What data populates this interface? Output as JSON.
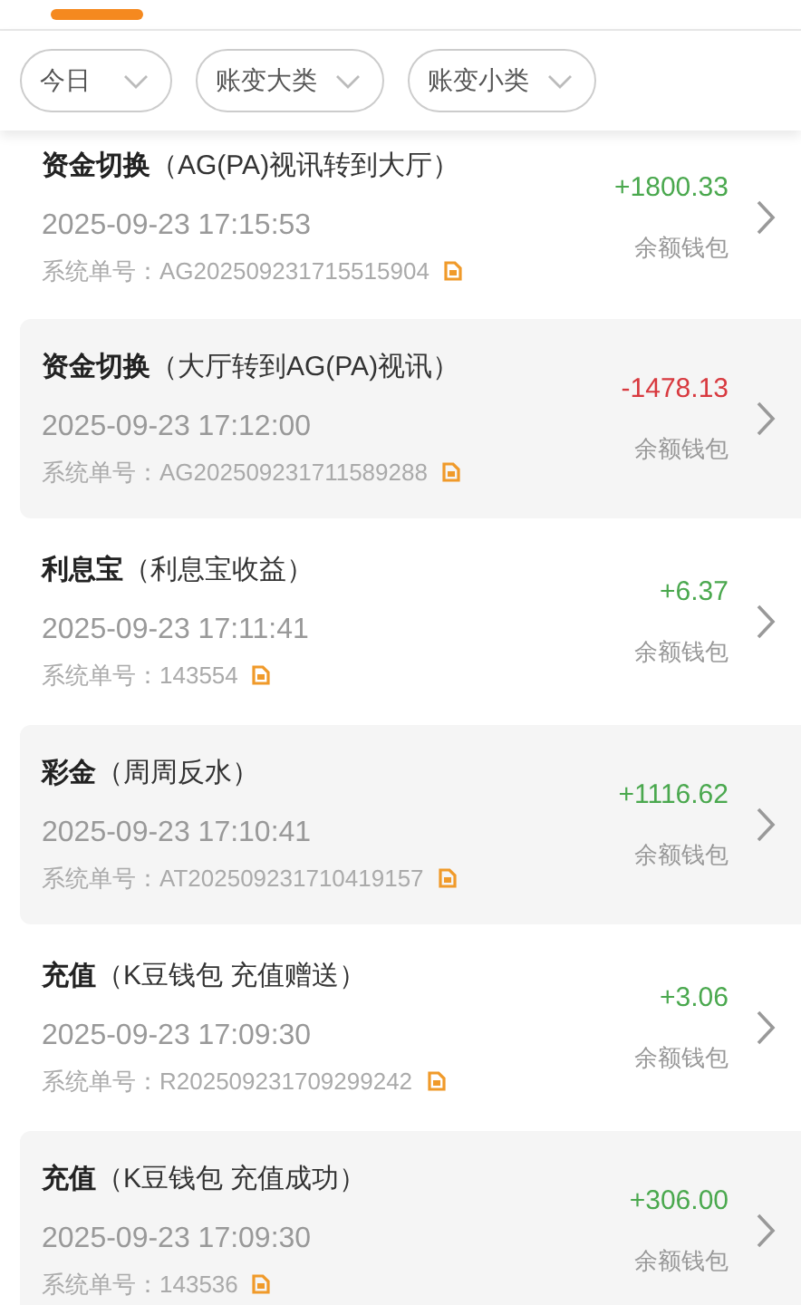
{
  "filters": [
    {
      "label": "今日"
    },
    {
      "label": "账变大类"
    },
    {
      "label": "账变小类"
    }
  ],
  "records": [
    {
      "category": "资金切换",
      "detail": "（AG(PA)视讯转到大厅）",
      "time": "2025-09-23 17:15:53",
      "order_label": "系统单号：",
      "order_no": "AG202509231715515904",
      "amount": "+1800.33",
      "kind": "credit",
      "wallet": "余额钱包"
    },
    {
      "category": "资金切换",
      "detail": "（大厅转到AG(PA)视讯）",
      "time": "2025-09-23 17:12:00",
      "order_label": "系统单号：",
      "order_no": "AG202509231711589288",
      "amount": "-1478.13",
      "kind": "debit",
      "wallet": "余额钱包"
    },
    {
      "category": "利息宝",
      "detail": "（利息宝收益）",
      "time": "2025-09-23 17:11:41",
      "order_label": "系统单号：",
      "order_no": "143554",
      "amount": "+6.37",
      "kind": "credit",
      "wallet": "余额钱包"
    },
    {
      "category": "彩金",
      "detail": "（周周反水）",
      "time": "2025-09-23 17:10:41",
      "order_label": "系统单号：",
      "order_no": "AT202509231710419157",
      "amount": "+1116.62",
      "kind": "credit",
      "wallet": "余额钱包"
    },
    {
      "category": "充值",
      "detail": "（K豆钱包 充值赠送）",
      "time": "2025-09-23 17:09:30",
      "order_label": "系统单号：",
      "order_no": "R202509231709299242",
      "amount": "+3.06",
      "kind": "credit",
      "wallet": "余额钱包"
    },
    {
      "category": "充值",
      "detail": "（K豆钱包 充值成功）",
      "time": "2025-09-23 17:09:30",
      "order_label": "系统单号：",
      "order_no": "143536",
      "amount": "+306.00",
      "kind": "credit",
      "wallet": "余额钱包"
    }
  ]
}
